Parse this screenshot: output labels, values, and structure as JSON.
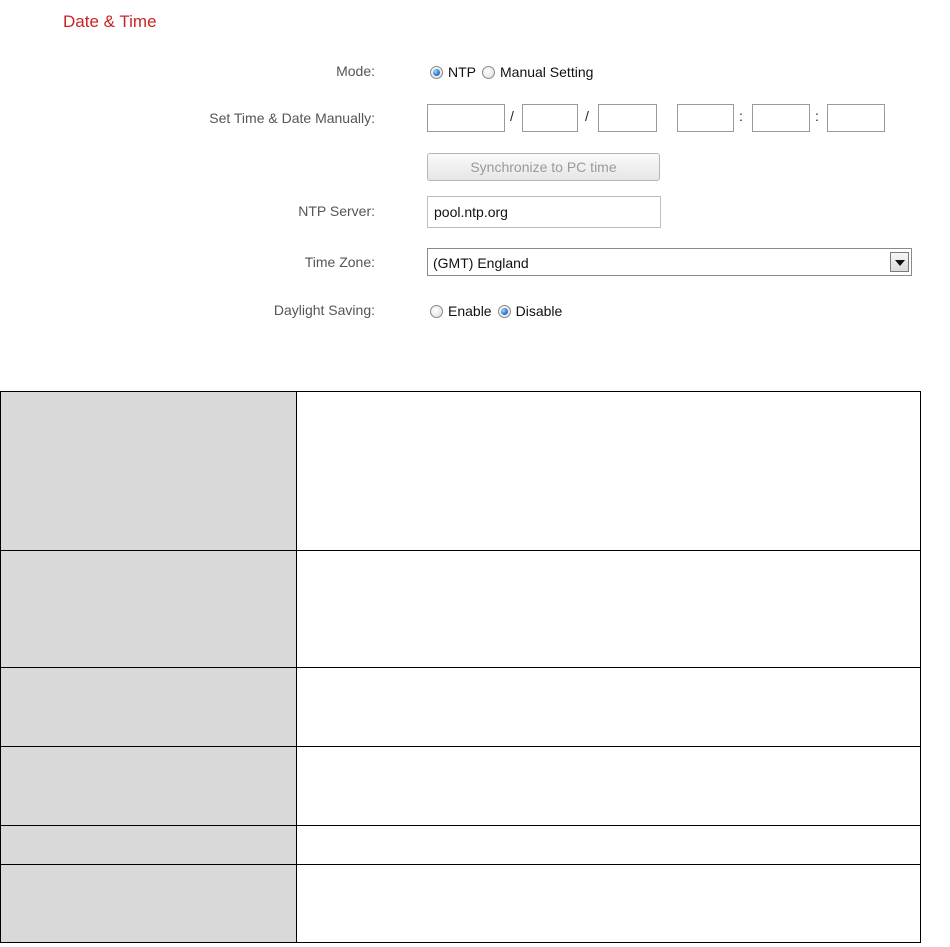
{
  "section": {
    "title": "Date & Time"
  },
  "form": {
    "mode": {
      "label": "Mode:",
      "options": [
        {
          "label": "NTP",
          "checked": true
        },
        {
          "label": "Manual Setting",
          "checked": false
        }
      ]
    },
    "manual": {
      "label": "Set Time & Date Manually:",
      "date_separator": "/",
      "time_separator": ":",
      "sync_button": "Synchronize to PC time"
    },
    "ntp_server": {
      "label": "NTP Server:",
      "value": "pool.ntp.org"
    },
    "time_zone": {
      "label": "Time Zone:",
      "value": "(GMT) England"
    },
    "daylight_saving": {
      "label": "Daylight Saving:",
      "options": [
        {
          "label": "Enable",
          "checked": false
        },
        {
          "label": "Disable",
          "checked": true
        }
      ]
    }
  },
  "table": {
    "rows": 6
  }
}
